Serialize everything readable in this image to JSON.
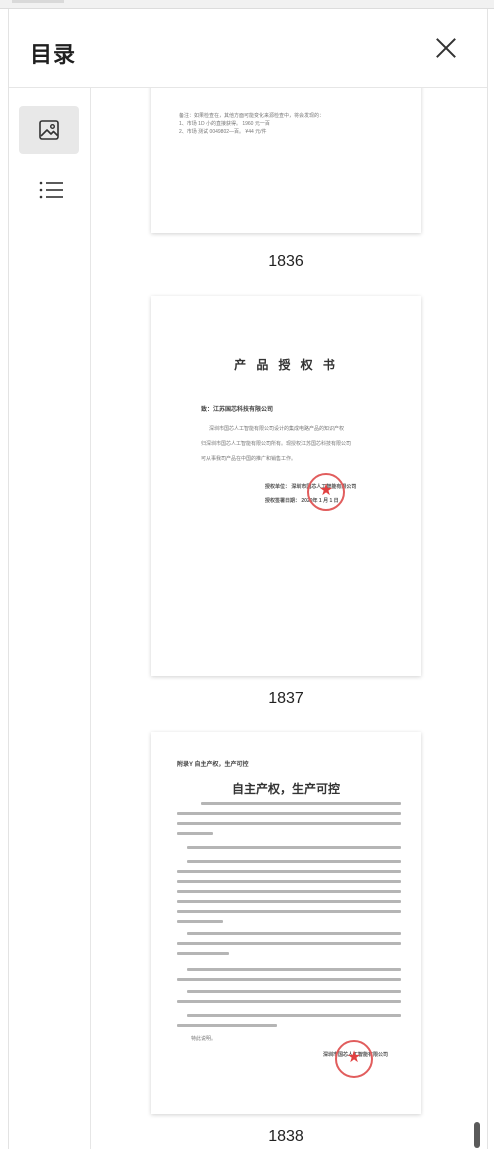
{
  "panel": {
    "title": "目录"
  },
  "rail": {
    "active": "thumbnails"
  },
  "pages": [
    {
      "number": "1836",
      "note_lines": [
        "备注：如果检查在，其他方面可能变化来源检查中，将会发现的：",
        "1、市场 1D 小的直接获得。   1960 元一百",
        "2、市场 测试 0049802—百。    ¥44 元/件"
      ]
    },
    {
      "number": "1837",
      "title": "产 品 授 权 书",
      "to_line": "致：江苏国芯科技有限公司",
      "body_lines": [
        "深圳市国芯人工智能有限公司设计的集成电路产品的知识产权",
        "归深圳市国芯人工智能有限公司所有。现授权江苏国芯科技有限公司",
        "可从事我司产品在中国的推广和销售工作。"
      ],
      "sign_lines": [
        "授权单位：   深圳市国芯人工智能有限公司",
        "授权签署日期：  2020年 1 月 1 日"
      ]
    },
    {
      "number": "1838",
      "attachment": "附录Y      自主产权，生产可控",
      "title": "自主产权，生产可控",
      "signature": "深圳市国芯人工智能有限公司",
      "closing": "特此说明。"
    }
  ]
}
